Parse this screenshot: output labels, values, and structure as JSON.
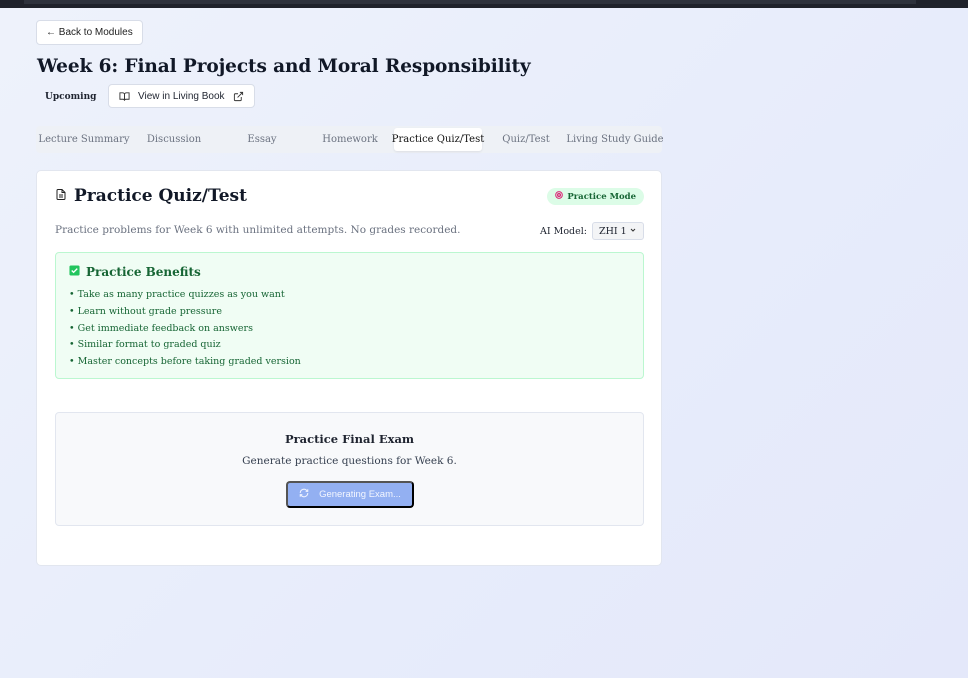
{
  "nav": {
    "back_label": "← Back to Modules"
  },
  "header": {
    "title": "Week 6: Final Projects and Moral Responsibility",
    "status": "Upcoming",
    "living_book_label": "View in Living Book"
  },
  "tabs": [
    {
      "label": "Lecture Summary",
      "active": false
    },
    {
      "label": "Discussion",
      "active": false
    },
    {
      "label": "Essay",
      "active": false
    },
    {
      "label": "Homework",
      "active": false
    },
    {
      "label": "Practice Quiz/Test",
      "active": true
    },
    {
      "label": "Quiz/Test",
      "active": false
    },
    {
      "label": "Living Study Guide",
      "active": false
    }
  ],
  "card": {
    "title": "Practice Quiz/Test",
    "badge": "Practice Mode",
    "subtitle": "Practice problems for Week 6 with unlimited attempts. No grades recorded.",
    "ai_model_label": "AI Model:",
    "ai_model_value": "ZHI 1"
  },
  "benefits": {
    "title": "Practice Benefits",
    "items": [
      "• Take as many practice quizzes as you want",
      "• Learn without grade pressure",
      "• Get immediate feedback on answers",
      "• Similar format to graded quiz",
      "• Master concepts before taking graded version"
    ]
  },
  "exam": {
    "title": "Practice Final Exam",
    "description": "Generate practice questions for Week 6.",
    "button_label": "Generating Exam..."
  },
  "colors": {
    "accent_green": "#166534",
    "button_disabled": "#93b0f2"
  }
}
